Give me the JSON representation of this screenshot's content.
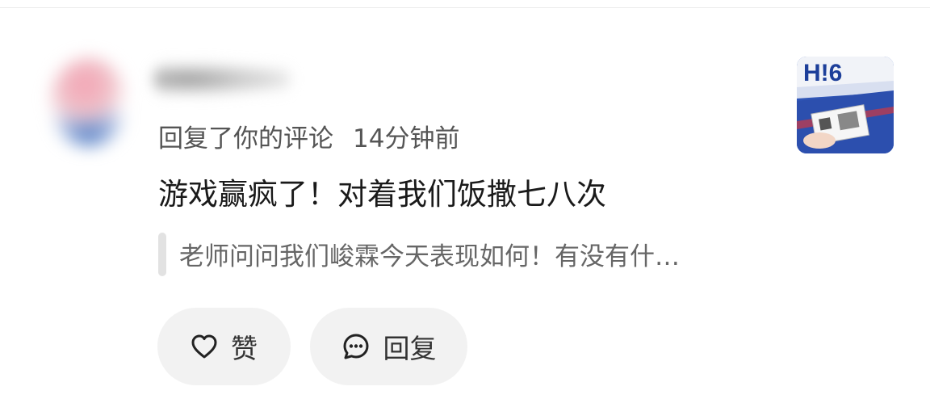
{
  "notification": {
    "action_text": "回复了你的评论",
    "time": "14分钟前",
    "comment": "游戏赢疯了！对着我们饭撒七八次",
    "quoted_comment": "老师问问我们峻霖今天表现如何！有没有什…",
    "thumbnail_text": "H!6"
  },
  "actions": {
    "like_label": "赞",
    "reply_label": "回复"
  },
  "colors": {
    "button_bg": "#f2f2f2",
    "text_primary": "#1a1a1a",
    "text_secondary": "#555555",
    "thumbnail_blue": "#2f56b8"
  },
  "icons": {
    "like": "heart-outline-icon",
    "reply": "speech-bubble-dots-icon"
  }
}
